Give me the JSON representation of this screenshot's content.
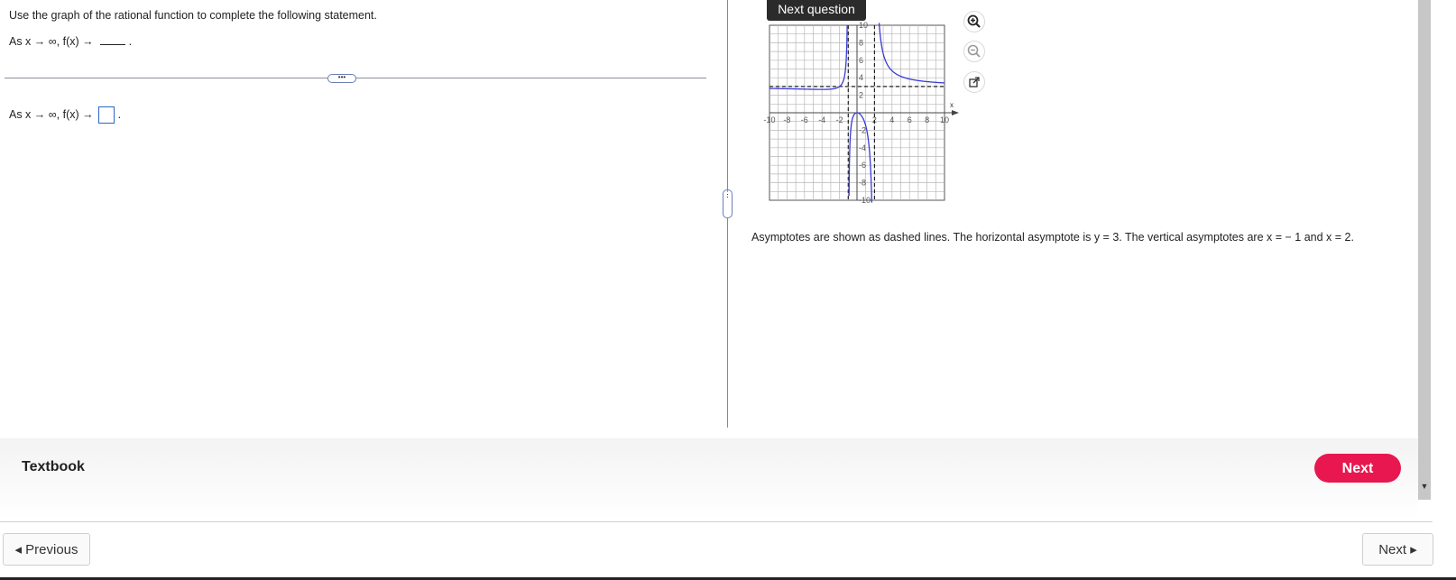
{
  "question": {
    "instruction": "Use the graph of the rational function to complete the following statement.",
    "statement": "As x → ∞, f(x) →",
    "period": ".",
    "answer_prompt": "As x → ∞, f(x) →",
    "answer_value": ""
  },
  "graph": {
    "x_tick_labels": [
      "-10",
      "-8",
      "-6",
      "-4",
      "-2",
      "2",
      "4",
      "6",
      "8",
      "10"
    ],
    "y_tick_labels": [
      "10",
      "8",
      "6",
      "4",
      "2",
      "-2",
      "-4",
      "-6",
      "-8",
      "-10"
    ],
    "x_axis_label": "x",
    "horizontal_asymptote": 3,
    "vertical_asymptotes": [
      -1,
      2
    ],
    "curve_color": "#3a3ad6",
    "asymptote_color": "#222222",
    "zoom_in": "zoom-in-icon",
    "zoom_out": "zoom-out-icon",
    "popout": "external-link-icon"
  },
  "tooltip": {
    "label": "Next question"
  },
  "caption": "Asymptotes are shown as dashed lines. The horizontal asymptote is y = 3. The vertical asymptotes are x = − 1 and x = 2.",
  "footer": {
    "textbook": "Textbook",
    "next_pill": "Next",
    "previous": "◂ Previous",
    "next": "Next ▸"
  },
  "colors": {
    "accent": "#e8174f",
    "divider": "#7f8aa3",
    "answer_box": "#2b67c6"
  }
}
